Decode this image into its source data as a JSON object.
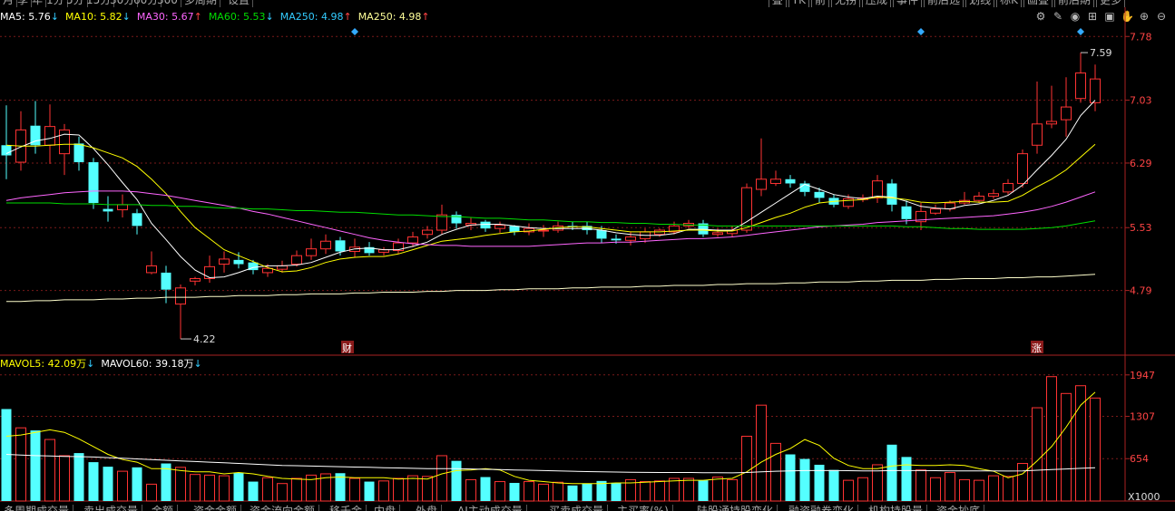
{
  "top_tabs": [
    "月",
    "季",
    "年",
    "1分",
    "5分",
    "15分",
    "30分",
    "60分",
    "300",
    "多周期",
    "设置"
  ],
  "top_right_tabs": [
    "叠",
    "TK",
    "前",
    "无拐",
    "压成",
    "事件",
    "前后选",
    "划线",
    "标K",
    "画叠",
    "前后期",
    "更多"
  ],
  "ma_legend": [
    {
      "label": "MA5: 5.76",
      "arrow": "↓",
      "color": "#ffffff"
    },
    {
      "label": "MA10: 5.82",
      "arrow": "↓",
      "color": "#ffff00"
    },
    {
      "label": "MA30: 5.67",
      "arrow": "↑",
      "color": "#ff66ff"
    },
    {
      "label": "MA60: 5.53",
      "arrow": "↓",
      "color": "#00dd00"
    },
    {
      "label": "MA250: 4.98",
      "arrow": "↑",
      "color": "#33ccff"
    },
    {
      "label": "MA250: 4.98",
      "arrow": "↑",
      "color": "#ffff99"
    }
  ],
  "vol_legend": [
    {
      "label": "MAVOL5: 42.09万",
      "arrow": "↓",
      "color": "#ffff00"
    },
    {
      "label": "MAVOL60: 39.18万",
      "arrow": "↓",
      "color": "#ffffff"
    }
  ],
  "toolbar_icons": [
    "settings-icon",
    "pen-icon",
    "eye-icon",
    "basket-icon",
    "shirt-icon",
    "hand-icon",
    "zoom-in-icon",
    "zoom-out-icon"
  ],
  "bottom_tabs": [
    "多周期成交量",
    "卖出成交量",
    "金额",
    "资金金额",
    "资金流向金额",
    "移千金",
    "内盘",
    "外盘",
    "AI主动成交量",
    "买卖成交量",
    "主买率(%)",
    "陆股通持股变化",
    "融资融券变化",
    "机构持股量",
    "资金抄底"
  ],
  "annotations": {
    "high_label": "7.59",
    "low_label": "4.22",
    "marker_cai": "财",
    "marker_zhang": "涨",
    "vol_unit": "X1000"
  },
  "chart_data": {
    "type": "candlestick",
    "price_axis": {
      "ticks": [
        7.78,
        7.03,
        6.29,
        5.53,
        4.79
      ],
      "ylim": [
        4.05,
        7.9
      ]
    },
    "volume_axis": {
      "ticks": [
        1947,
        1307,
        654
      ],
      "unit": "X1000",
      "ylim": [
        0,
        2000
      ]
    },
    "candles": [
      [
        6.5,
        6.38,
        6.97,
        6.1
      ],
      [
        6.3,
        6.68,
        6.9,
        6.2
      ],
      [
        6.73,
        6.5,
        7.02,
        6.4
      ],
      [
        6.5,
        6.72,
        6.98,
        6.28
      ],
      [
        6.4,
        6.68,
        6.75,
        6.15
      ],
      [
        6.52,
        6.3,
        6.6,
        6.2
      ],
      [
        6.3,
        5.82,
        6.35,
        5.75
      ],
      [
        5.75,
        5.72,
        5.9,
        5.6
      ],
      [
        5.74,
        5.8,
        5.92,
        5.65
      ],
      [
        5.7,
        5.55,
        5.75,
        5.45
      ],
      [
        5.0,
        5.08,
        5.25,
        4.98
      ],
      [
        5.0,
        4.8,
        5.08,
        4.64
      ],
      [
        4.63,
        4.82,
        4.86,
        4.22
      ],
      [
        4.9,
        4.93,
        4.95,
        4.85
      ],
      [
        4.93,
        5.07,
        5.2,
        4.88
      ],
      [
        5.1,
        5.16,
        5.25,
        5.0
      ],
      [
        5.15,
        5.1,
        5.24,
        5.05
      ],
      [
        5.12,
        5.03,
        5.15,
        4.98
      ],
      [
        5.0,
        5.05,
        5.1,
        4.95
      ],
      [
        5.04,
        5.08,
        5.14,
        5.0
      ],
      [
        5.1,
        5.2,
        5.26,
        5.07
      ],
      [
        5.2,
        5.28,
        5.4,
        5.15
      ],
      [
        5.28,
        5.37,
        5.45,
        5.22
      ],
      [
        5.38,
        5.25,
        5.42,
        5.2
      ],
      [
        5.25,
        5.3,
        5.4,
        5.18
      ],
      [
        5.3,
        5.23,
        5.36,
        5.2
      ],
      [
        5.24,
        5.27,
        5.3,
        5.2
      ],
      [
        5.26,
        5.35,
        5.4,
        5.22
      ],
      [
        5.35,
        5.42,
        5.48,
        5.3
      ],
      [
        5.45,
        5.5,
        5.55,
        5.4
      ],
      [
        5.5,
        5.68,
        5.8,
        5.45
      ],
      [
        5.68,
        5.58,
        5.72,
        5.52
      ],
      [
        5.56,
        5.58,
        5.65,
        5.5
      ],
      [
        5.6,
        5.52,
        5.62,
        5.48
      ],
      [
        5.52,
        5.56,
        5.6,
        5.47
      ],
      [
        5.55,
        5.48,
        5.56,
        5.44
      ],
      [
        5.48,
        5.52,
        5.58,
        5.44
      ],
      [
        5.5,
        5.5,
        5.56,
        5.42
      ],
      [
        5.5,
        5.55,
        5.6,
        5.47
      ],
      [
        5.55,
        5.54,
        5.6,
        5.5
      ],
      [
        5.55,
        5.5,
        5.6,
        5.45
      ],
      [
        5.5,
        5.4,
        5.55,
        5.35
      ],
      [
        5.4,
        5.38,
        5.45,
        5.34
      ],
      [
        5.38,
        5.42,
        5.48,
        5.32
      ],
      [
        5.4,
        5.48,
        5.52,
        5.35
      ],
      [
        5.45,
        5.5,
        5.52,
        5.42
      ],
      [
        5.48,
        5.55,
        5.6,
        5.45
      ],
      [
        5.55,
        5.58,
        5.62,
        5.52
      ],
      [
        5.58,
        5.45,
        5.62,
        5.42
      ],
      [
        5.45,
        5.47,
        5.52,
        5.42
      ],
      [
        5.46,
        5.5,
        5.55,
        5.42
      ],
      [
        5.5,
        6.0,
        6.05,
        5.47
      ],
      [
        5.98,
        6.1,
        6.58,
        5.9
      ],
      [
        6.05,
        6.1,
        6.2,
        6.02
      ],
      [
        6.1,
        6.05,
        6.15,
        6.0
      ],
      [
        6.05,
        5.95,
        6.08,
        5.9
      ],
      [
        5.95,
        5.88,
        6.0,
        5.82
      ],
      [
        5.88,
        5.8,
        5.92,
        5.77
      ],
      [
        5.78,
        5.87,
        5.92,
        5.75
      ],
      [
        5.86,
        5.88,
        5.92,
        5.83
      ],
      [
        5.88,
        6.08,
        6.15,
        5.82
      ],
      [
        6.05,
        5.8,
        6.1,
        5.72
      ],
      [
        5.78,
        5.63,
        5.85,
        5.57
      ],
      [
        5.6,
        5.72,
        5.82,
        5.5
      ],
      [
        5.7,
        5.75,
        5.8,
        5.68
      ],
      [
        5.75,
        5.82,
        5.85,
        5.72
      ],
      [
        5.82,
        5.85,
        5.95,
        5.8
      ],
      [
        5.85,
        5.9,
        5.95,
        5.82
      ],
      [
        5.9,
        5.93,
        5.98,
        5.87
      ],
      [
        5.95,
        6.05,
        6.1,
        5.92
      ],
      [
        6.05,
        6.4,
        6.45,
        6.0
      ],
      [
        6.5,
        6.75,
        7.25,
        6.4
      ],
      [
        6.75,
        6.78,
        7.2,
        6.7
      ],
      [
        6.8,
        6.95,
        7.3,
        6.6
      ],
      [
        7.05,
        7.35,
        7.59,
        7.0
      ],
      [
        7.0,
        7.28,
        7.45,
        6.9
      ]
    ],
    "volumes": [
      1420,
      1130,
      1090,
      950,
      700,
      740,
      600,
      530,
      460,
      520,
      260,
      580,
      520,
      410,
      400,
      390,
      440,
      300,
      360,
      270,
      350,
      400,
      420,
      430,
      350,
      300,
      310,
      350,
      390,
      380,
      700,
      620,
      330,
      370,
      300,
      280,
      300,
      260,
      290,
      240,
      270,
      310,
      280,
      330,
      300,
      310,
      350,
      350,
      320,
      370,
      330,
      1000,
      1480,
      890,
      720,
      650,
      560,
      480,
      320,
      360,
      560,
      870,
      680,
      480,
      360,
      440,
      330,
      320,
      390,
      380,
      580,
      1440,
      1920,
      1660,
      1780,
      1590
    ],
    "ma_lines": [
      {
        "name": "MA5",
        "color": "#ffffff",
        "values": [
          6.4,
          6.48,
          6.55,
          6.58,
          6.63,
          6.62,
          6.46,
          6.27,
          6.06,
          5.86,
          5.58,
          5.39,
          5.19,
          5.03,
          4.94,
          4.95,
          5.0,
          5.06,
          5.08,
          5.08,
          5.09,
          5.12,
          5.18,
          5.24,
          5.28,
          5.29,
          5.27,
          5.27,
          5.31,
          5.36,
          5.45,
          5.51,
          5.56,
          5.57,
          5.57,
          5.55,
          5.53,
          5.52,
          5.52,
          5.52,
          5.52,
          5.5,
          5.47,
          5.45,
          5.44,
          5.44,
          5.46,
          5.51,
          5.51,
          5.5,
          5.5,
          5.6,
          5.71,
          5.82,
          5.93,
          6.04,
          5.98,
          5.92,
          5.89,
          5.87,
          5.9,
          5.89,
          5.84,
          5.78,
          5.76,
          5.75,
          5.79,
          5.81,
          5.85,
          5.91,
          6.03,
          6.21,
          6.38,
          6.57,
          6.85,
          7.03
        ]
      },
      {
        "name": "MA10",
        "color": "#ffff00",
        "values": [
          6.5,
          6.49,
          6.49,
          6.5,
          6.51,
          6.51,
          6.47,
          6.41,
          6.35,
          6.25,
          6.1,
          5.93,
          5.72,
          5.53,
          5.4,
          5.27,
          5.2,
          5.13,
          5.06,
          5.01,
          5.02,
          5.06,
          5.12,
          5.16,
          5.18,
          5.19,
          5.19,
          5.22,
          5.27,
          5.32,
          5.37,
          5.39,
          5.41,
          5.44,
          5.46,
          5.48,
          5.49,
          5.51,
          5.53,
          5.54,
          5.54,
          5.52,
          5.5,
          5.48,
          5.48,
          5.48,
          5.49,
          5.5,
          5.5,
          5.49,
          5.49,
          5.53,
          5.59,
          5.65,
          5.7,
          5.77,
          5.82,
          5.84,
          5.85,
          5.86,
          5.89,
          5.88,
          5.86,
          5.83,
          5.82,
          5.83,
          5.84,
          5.83,
          5.83,
          5.84,
          5.91,
          6.01,
          6.1,
          6.21,
          6.36,
          6.51
        ]
      },
      {
        "name": "MA30",
        "color": "#ff66ff",
        "values": [
          5.85,
          5.88,
          5.9,
          5.92,
          5.94,
          5.95,
          5.96,
          5.96,
          5.96,
          5.95,
          5.93,
          5.91,
          5.88,
          5.85,
          5.82,
          5.79,
          5.76,
          5.72,
          5.69,
          5.65,
          5.61,
          5.57,
          5.53,
          5.49,
          5.45,
          5.41,
          5.38,
          5.36,
          5.34,
          5.33,
          5.32,
          5.32,
          5.31,
          5.31,
          5.31,
          5.31,
          5.31,
          5.32,
          5.33,
          5.34,
          5.35,
          5.35,
          5.36,
          5.36,
          5.37,
          5.38,
          5.39,
          5.4,
          5.4,
          5.41,
          5.42,
          5.44,
          5.46,
          5.48,
          5.5,
          5.52,
          5.54,
          5.55,
          5.56,
          5.57,
          5.59,
          5.6,
          5.61,
          5.62,
          5.63,
          5.64,
          5.65,
          5.66,
          5.67,
          5.69,
          5.71,
          5.74,
          5.78,
          5.83,
          5.89,
          5.95
        ]
      },
      {
        "name": "MA60",
        "color": "#00dd00",
        "values": [
          5.82,
          5.82,
          5.82,
          5.82,
          5.81,
          5.81,
          5.81,
          5.8,
          5.8,
          5.8,
          5.79,
          5.79,
          5.78,
          5.78,
          5.77,
          5.76,
          5.76,
          5.75,
          5.75,
          5.74,
          5.73,
          5.73,
          5.72,
          5.71,
          5.71,
          5.7,
          5.69,
          5.68,
          5.68,
          5.67,
          5.66,
          5.66,
          5.65,
          5.64,
          5.64,
          5.63,
          5.62,
          5.62,
          5.61,
          5.6,
          5.6,
          5.59,
          5.59,
          5.58,
          5.58,
          5.57,
          5.57,
          5.56,
          5.56,
          5.55,
          5.55,
          5.55,
          5.55,
          5.55,
          5.55,
          5.55,
          5.55,
          5.55,
          5.55,
          5.55,
          5.55,
          5.55,
          5.54,
          5.54,
          5.53,
          5.52,
          5.52,
          5.51,
          5.51,
          5.51,
          5.51,
          5.52,
          5.53,
          5.55,
          5.58,
          5.61
        ]
      },
      {
        "name": "MA250",
        "color": "#ffffcc",
        "values": [
          4.66,
          4.66,
          4.67,
          4.67,
          4.68,
          4.68,
          4.68,
          4.69,
          4.69,
          4.7,
          4.7,
          4.71,
          4.71,
          4.71,
          4.72,
          4.72,
          4.73,
          4.73,
          4.73,
          4.74,
          4.74,
          4.75,
          4.75,
          4.75,
          4.76,
          4.76,
          4.77,
          4.77,
          4.77,
          4.78,
          4.78,
          4.79,
          4.79,
          4.79,
          4.8,
          4.8,
          4.81,
          4.81,
          4.81,
          4.82,
          4.82,
          4.83,
          4.83,
          4.83,
          4.84,
          4.84,
          4.85,
          4.85,
          4.85,
          4.86,
          4.86,
          4.87,
          4.87,
          4.87,
          4.88,
          4.88,
          4.89,
          4.89,
          4.89,
          4.9,
          4.9,
          4.91,
          4.91,
          4.91,
          4.92,
          4.92,
          4.93,
          4.93,
          4.93,
          4.94,
          4.94,
          4.95,
          4.95,
          4.96,
          4.97,
          4.98
        ]
      }
    ],
    "vol_ma_lines": [
      {
        "name": "MAVOL5",
        "color": "#ffff00",
        "values": [
          1000,
          1020,
          1060,
          1100,
          1060,
          960,
          840,
          720,
          640,
          600,
          500,
          500,
          470,
          450,
          450,
          420,
          440,
          420,
          380,
          350,
          340,
          330,
          360,
          370,
          360,
          360,
          360,
          340,
          350,
          340,
          420,
          470,
          480,
          500,
          480,
          380,
          320,
          300,
          280,
          270,
          270,
          270,
          280,
          280,
          290,
          300,
          310,
          320,
          320,
          340,
          350,
          450,
          600,
          720,
          810,
          950,
          860,
          660,
          550,
          500,
          500,
          540,
          560,
          550,
          550,
          560,
          550,
          500,
          460,
          360,
          420,
          620,
          840,
          1140,
          1480,
          1680
        ]
      },
      {
        "name": "MAVOL60",
        "color": "#ffffff",
        "values": [
          720,
          710,
          700,
          695,
          690,
          685,
          680,
          670,
          660,
          650,
          640,
          630,
          620,
          610,
          600,
          590,
          580,
          570,
          560,
          550,
          545,
          540,
          535,
          530,
          525,
          520,
          515,
          510,
          505,
          500,
          500,
          500,
          495,
          490,
          485,
          480,
          475,
          470,
          465,
          460,
          455,
          450,
          448,
          445,
          442,
          440,
          440,
          440,
          438,
          436,
          435,
          440,
          450,
          460,
          465,
          470,
          470,
          470,
          468,
          466,
          465,
          470,
          470,
          470,
          468,
          466,
          465,
          465,
          464,
          463,
          465,
          475,
          485,
          495,
          505,
          515
        ]
      }
    ]
  }
}
